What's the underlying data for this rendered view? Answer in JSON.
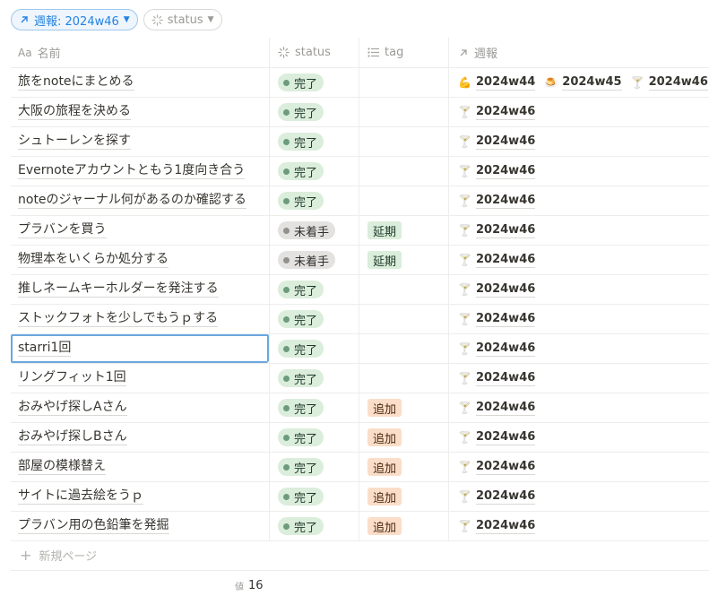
{
  "filter_bar": {
    "active_view_label": "週報: 2024w46",
    "status_filter_label": "status"
  },
  "columns": {
    "name": "名前",
    "name_icon": "Aa",
    "status": "status",
    "tag": "tag",
    "week": "週報"
  },
  "rows": [
    {
      "name": "旅をnoteにまとめる",
      "status": "完了",
      "status_type": "done",
      "tag": "",
      "tag_color": "",
      "weeks": [
        {
          "label": "2024w44",
          "icon": "muscle-icon",
          "glyph": "💪"
        },
        {
          "label": "2024w45",
          "icon": "pudding-icon",
          "glyph": "🍮"
        },
        {
          "label": "2024w46",
          "icon": "cocktail-icon",
          "glyph": "🍸"
        }
      ]
    },
    {
      "name": "大阪の旅程を決める",
      "status": "完了",
      "status_type": "done",
      "tag": "",
      "tag_color": "",
      "weeks": [
        {
          "label": "2024w46",
          "icon": "cocktail-icon",
          "glyph": "🍸"
        }
      ]
    },
    {
      "name": "シュトーレンを探す",
      "status": "完了",
      "status_type": "done",
      "tag": "",
      "tag_color": "",
      "weeks": [
        {
          "label": "2024w46",
          "icon": "cocktail-icon",
          "glyph": "🍸"
        }
      ]
    },
    {
      "name": "Evernoteアカウントともう1度向き合う",
      "status": "完了",
      "status_type": "done",
      "tag": "",
      "tag_color": "",
      "weeks": [
        {
          "label": "2024w46",
          "icon": "cocktail-icon",
          "glyph": "🍸"
        }
      ]
    },
    {
      "name": "noteのジャーナル何があるのか確認する",
      "status": "完了",
      "status_type": "done",
      "tag": "",
      "tag_color": "",
      "weeks": [
        {
          "label": "2024w46",
          "icon": "cocktail-icon",
          "glyph": "🍸"
        }
      ]
    },
    {
      "name": "プラバンを買う",
      "status": "未着手",
      "status_type": "todo",
      "tag": "延期",
      "tag_color": "green",
      "weeks": [
        {
          "label": "2024w46",
          "icon": "cocktail-icon",
          "glyph": "🍸"
        }
      ]
    },
    {
      "name": "物理本をいくらか処分する",
      "status": "未着手",
      "status_type": "todo",
      "tag": "延期",
      "tag_color": "green",
      "weeks": [
        {
          "label": "2024w46",
          "icon": "cocktail-icon",
          "glyph": "🍸"
        }
      ]
    },
    {
      "name": "推しネームキーホルダーを発注する",
      "status": "完了",
      "status_type": "done",
      "tag": "",
      "tag_color": "",
      "weeks": [
        {
          "label": "2024w46",
          "icon": "cocktail-icon",
          "glyph": "🍸"
        }
      ]
    },
    {
      "name": "ストックフォトを少しでもうｐする",
      "status": "完了",
      "status_type": "done",
      "tag": "",
      "tag_color": "",
      "weeks": [
        {
          "label": "2024w46",
          "icon": "cocktail-icon",
          "glyph": "🍸"
        }
      ]
    },
    {
      "name": "starri1回",
      "status": "完了",
      "status_type": "done",
      "tag": "",
      "tag_color": "",
      "selected": true,
      "weeks": [
        {
          "label": "2024w46",
          "icon": "cocktail-icon",
          "glyph": "🍸"
        }
      ]
    },
    {
      "name": "リングフィット1回",
      "status": "完了",
      "status_type": "done",
      "tag": "",
      "tag_color": "",
      "weeks": [
        {
          "label": "2024w46",
          "icon": "cocktail-icon",
          "glyph": "🍸"
        }
      ]
    },
    {
      "name": "おみやげ探しAさん",
      "status": "完了",
      "status_type": "done",
      "tag": "追加",
      "tag_color": "orange",
      "weeks": [
        {
          "label": "2024w46",
          "icon": "cocktail-icon",
          "glyph": "🍸"
        }
      ]
    },
    {
      "name": "おみやげ探しBさん",
      "status": "完了",
      "status_type": "done",
      "tag": "追加",
      "tag_color": "orange",
      "weeks": [
        {
          "label": "2024w46",
          "icon": "cocktail-icon",
          "glyph": "🍸"
        }
      ]
    },
    {
      "name": "部屋の模様替え",
      "status": "完了",
      "status_type": "done",
      "tag": "追加",
      "tag_color": "orange",
      "weeks": [
        {
          "label": "2024w46",
          "icon": "cocktail-icon",
          "glyph": "🍸"
        }
      ]
    },
    {
      "name": "サイトに過去絵をうｐ",
      "status": "完了",
      "status_type": "done",
      "tag": "追加",
      "tag_color": "orange",
      "weeks": [
        {
          "label": "2024w46",
          "icon": "cocktail-icon",
          "glyph": "🍸"
        }
      ]
    },
    {
      "name": "プラバン用の色鉛筆を発掘",
      "status": "完了",
      "status_type": "done",
      "tag": "追加",
      "tag_color": "orange",
      "weeks": [
        {
          "label": "2024w46",
          "icon": "cocktail-icon",
          "glyph": "🍸"
        }
      ]
    }
  ],
  "new_page_label": "新規ページ",
  "footer": {
    "count_label": "値",
    "count_value": "16"
  }
}
